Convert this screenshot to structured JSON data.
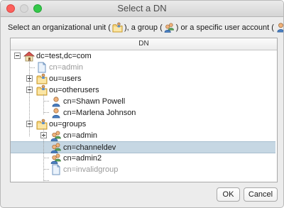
{
  "window": {
    "title": "Select a DN"
  },
  "instructions": {
    "part1": "Select an organizational unit (",
    "part2": "), a group (",
    "part3": ") or a specific user account (",
    "part4": "):"
  },
  "table": {
    "column_header": "DN"
  },
  "tree": [
    {
      "label": "dc=test,dc=com",
      "icon": "domain-icon",
      "toggle": "minus",
      "selected": false,
      "disabled": false
    },
    {
      "label": "cn=admin",
      "icon": "document-icon",
      "toggle": "",
      "selected": false,
      "disabled": true
    },
    {
      "label": "ou=users",
      "icon": "ou-folder-icon",
      "toggle": "plus",
      "selected": false,
      "disabled": false
    },
    {
      "label": "ou=otherusers",
      "icon": "ou-folder-icon",
      "toggle": "minus",
      "selected": false,
      "disabled": false
    },
    {
      "label": "cn=Shawn Powell",
      "icon": "user-icon",
      "toggle": "",
      "selected": false,
      "disabled": false
    },
    {
      "label": "cn=Marlena Johnson",
      "icon": "user-icon",
      "toggle": "",
      "selected": false,
      "disabled": false
    },
    {
      "label": "ou=groups",
      "icon": "ou-folder-icon",
      "toggle": "minus",
      "selected": false,
      "disabled": false
    },
    {
      "label": "cn=admin",
      "icon": "group-icon",
      "toggle": "plus",
      "selected": false,
      "disabled": false
    },
    {
      "label": "cn=channeldev",
      "icon": "group-icon",
      "toggle": "",
      "selected": true,
      "disabled": false
    },
    {
      "label": "cn=admin2",
      "icon": "group-icon",
      "toggle": "",
      "selected": false,
      "disabled": false
    },
    {
      "label": "cn=invalidgroup",
      "icon": "document-icon",
      "toggle": "",
      "selected": false,
      "disabled": true
    }
  ],
  "buttons": {
    "ok": "OK",
    "cancel": "Cancel"
  },
  "colors": {
    "selection": "#c6d7e3",
    "disabled_text": "#9a9a9a",
    "folder": "#f5d27a"
  }
}
